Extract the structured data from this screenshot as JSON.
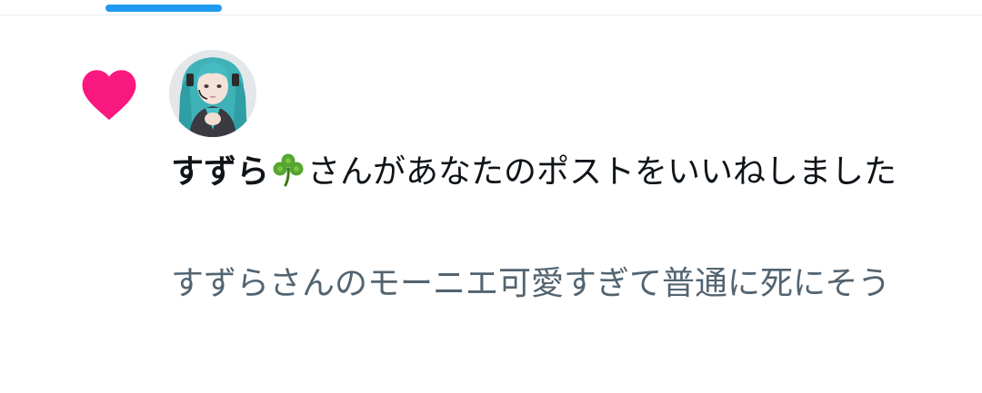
{
  "notification": {
    "type_icon": "heart-icon",
    "avatar_icon": "user-avatar",
    "username": "すずら",
    "username_emoji": "clover-icon",
    "action_text": "さんがあなたのポストをいいねしました",
    "post_excerpt": "すずらさんのモーニエ可愛すぎて普通に死にそう"
  },
  "colors": {
    "like": "#f91880",
    "accent": "#1d9bf0",
    "text": "#0f1419",
    "secondary_text": "#536471",
    "divider": "#e6ecf0"
  }
}
